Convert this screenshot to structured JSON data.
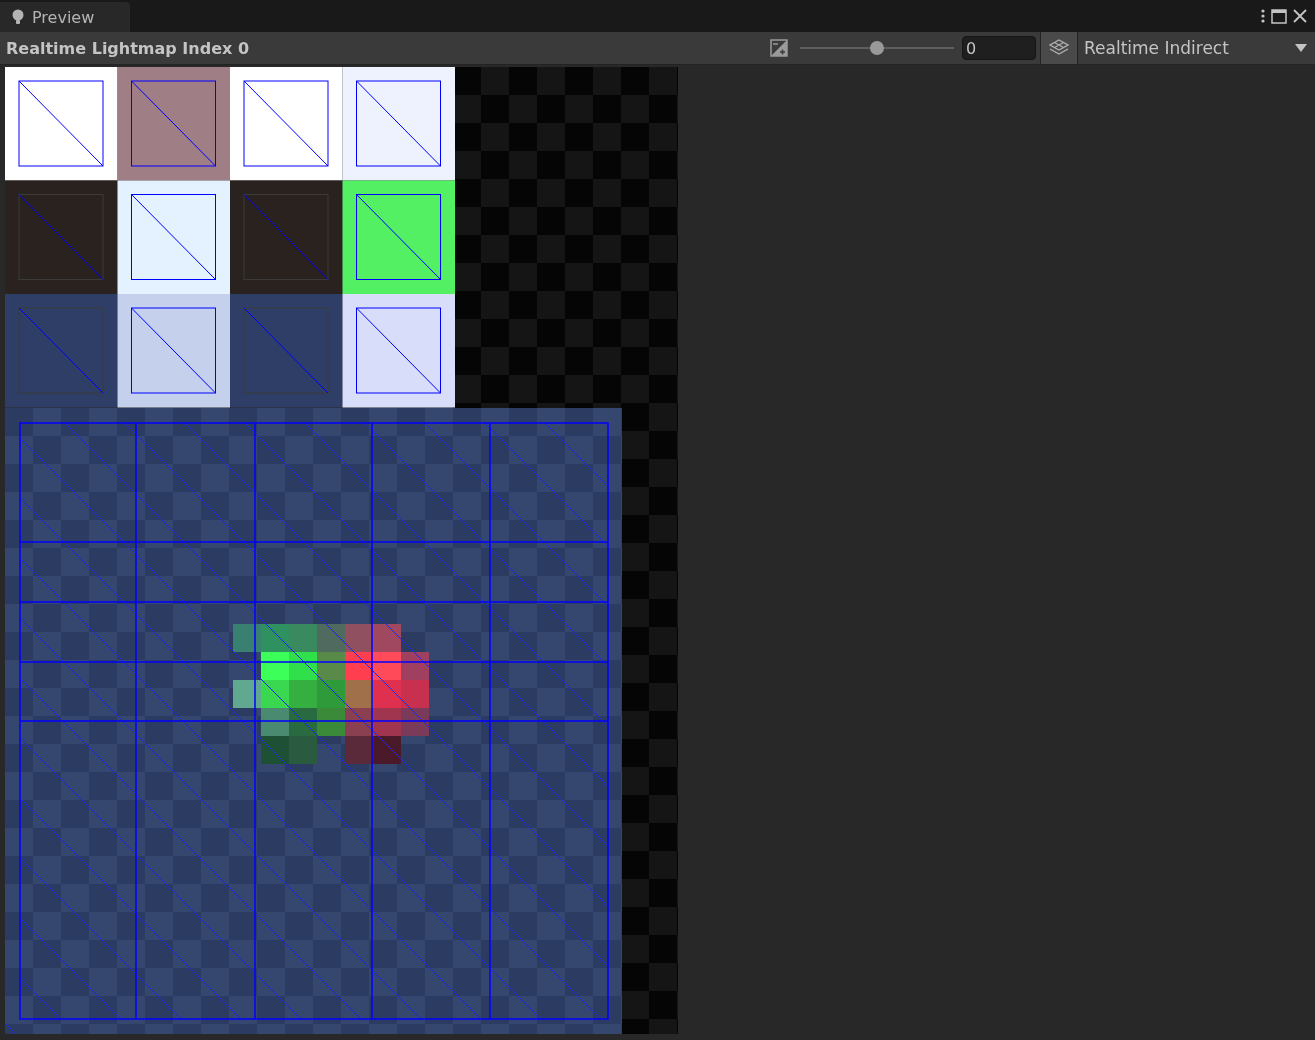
{
  "tab": {
    "label": "Preview",
    "selected": true
  },
  "toolbar": {
    "title": "Realtime Lightmap Index 0",
    "exposure": {
      "level": 0.5
    },
    "exposure_value": "0",
    "mode": "Realtime Indirect"
  }
}
